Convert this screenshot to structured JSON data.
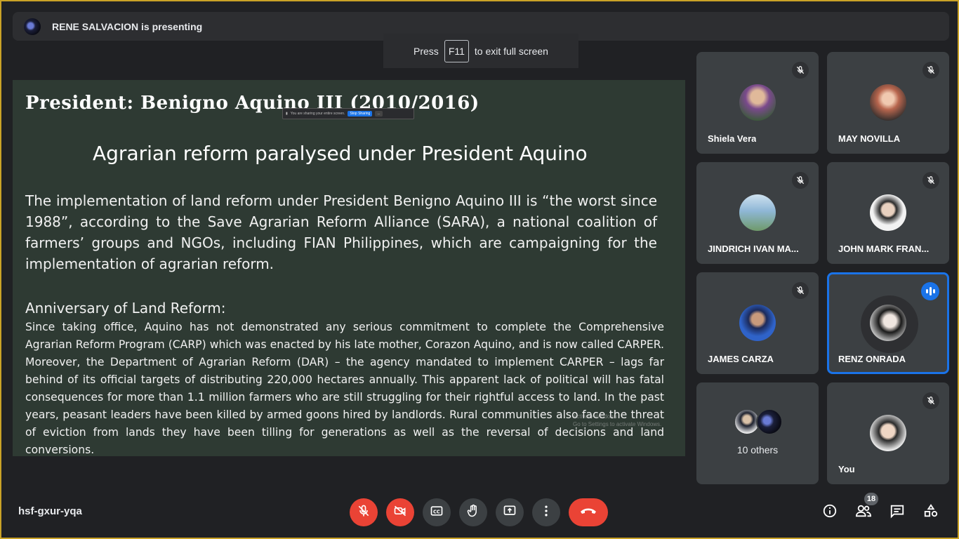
{
  "presenter": {
    "text": "RENE SALVACION is presenting"
  },
  "fullscreen_toast": {
    "prefix": "Press",
    "key": "F11",
    "suffix": "to exit full screen"
  },
  "slide": {
    "title": "President: Benigno Aquino III (2010/2016)",
    "share_bar": {
      "text": "You are sharing your entire screen.",
      "stop_label": "Stop Sharing",
      "more_label": "..."
    },
    "subtitle": "Agrarian reform paralysed under President Aquino",
    "paragraph": "The implementation of land reform under President Benigno Aquino III is “the worst since 1988”, according to the Save Agrarian Reform Alliance (SARA), a national coalition of farmers’ groups and NGOs, including FIAN Philippines, which are campaigning for the implementation of agrarian reform.",
    "heading": "Anniversary of Land Reform:",
    "body": "Since taking office, Aquino has not demonstrated any serious commitment to complete the Comprehensive Agrarian Reform Program (CARP) which was enacted by his late mother, Corazon Aquino, and is now called CARPER. Moreover, the Department of Agrarian Reform (DAR) – the agency mandated to implement CARPER – lags far behind of its official targets of distributing 220,000 hectares annually. This apparent lack of political will has fatal consequences for more than 1.1 million farmers who are still struggling for their rightful access to land. In the past years, peasant leaders have been killed by armed goons hired by landlords. Rural communities also face the threat of eviction from lands they have been tilling for generations as well as the reversal of decisions and land conversions.",
    "watermark_line1": "Activate Windows",
    "watermark_line2": "Go to Settings to activate Windows."
  },
  "participants": [
    {
      "name": "Shiela Vera",
      "muted": true,
      "avatar_color": "#7a4a8c"
    },
    {
      "name": "MAY NOVILLA",
      "muted": true,
      "avatar_color": "#b8664e"
    },
    {
      "name": "JINDRICH IVAN MA...",
      "muted": true,
      "avatar_color": "#8fb7d6"
    },
    {
      "name": "JOHN MARK FRAN...",
      "muted": true,
      "avatar_color": "#d9d9d9"
    },
    {
      "name": "JAMES CARZA",
      "muted": true,
      "avatar_color": "#2f63c9"
    },
    {
      "name": "RENZ ONRADA",
      "muted": false,
      "speaking": true,
      "avatar_color": "#cfcfcf"
    }
  ],
  "others": {
    "label": "10 others"
  },
  "self": {
    "name": "You",
    "muted": true
  },
  "bottom_bar": {
    "meeting_code": "hsf-gxur-yqa",
    "participant_count": "18",
    "icons": [
      "mic-off-icon",
      "camera-off-icon",
      "captions-icon",
      "raise-hand-icon",
      "present-icon",
      "more-icon",
      "hang-up-icon",
      "info-icon",
      "people-icon",
      "chat-icon",
      "activities-icon"
    ]
  },
  "colors": {
    "background": "#202124",
    "tile": "#3c4043",
    "danger": "#ea4335",
    "accent": "#1a73e8",
    "slide_bg": "#2e3a33"
  }
}
